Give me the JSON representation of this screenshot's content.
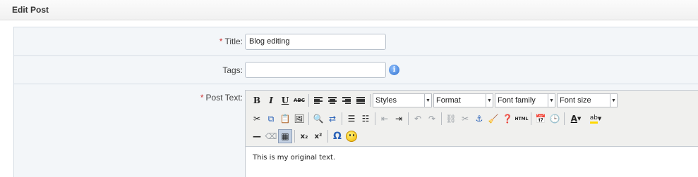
{
  "header": {
    "title": "Edit Post"
  },
  "form": {
    "title_field": {
      "required_mark": "*",
      "label": "Title:",
      "value": "Blog editing"
    },
    "tags_field": {
      "label": "Tags:",
      "value": "",
      "info_icon": "info-icon"
    },
    "post_text_field": {
      "required_mark": "*",
      "label": "Post Text:"
    }
  },
  "editor": {
    "dropdowns": {
      "styles": "Styles",
      "format": "Format",
      "font_family": "Font family",
      "font_size": "Font size"
    },
    "buttons": {
      "bold": "B",
      "italic": "I",
      "underline": "U",
      "strikethrough": "ABC",
      "subscript": "x₂",
      "superscript": "x²",
      "special_char": "Ω",
      "html": "HTML"
    },
    "content": "This is my original text."
  },
  "colors": {
    "required": "#cc3333",
    "row_bg": "#f3f6f9",
    "toolbar_bg": "#f0f0ee"
  }
}
